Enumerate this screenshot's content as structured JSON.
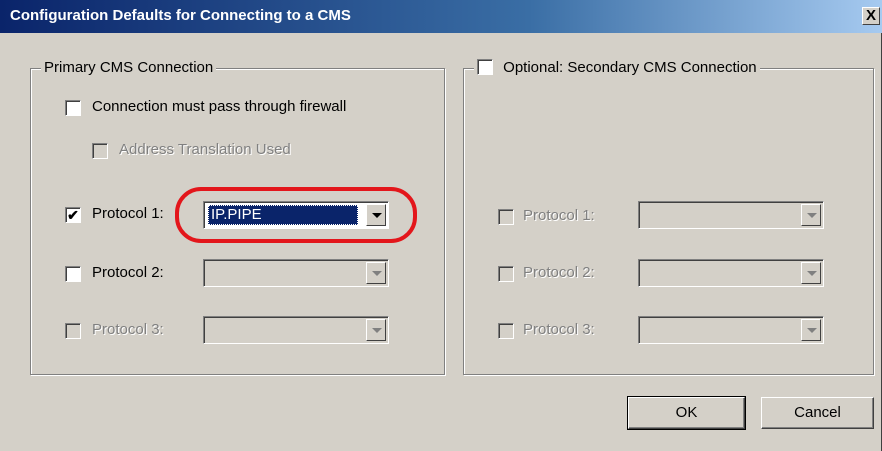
{
  "window": {
    "title": "Configuration Defaults for Connecting to a CMS",
    "close_label": "X"
  },
  "primary": {
    "legend": "Primary CMS Connection",
    "firewall_label": "Connection must pass through firewall",
    "firewall_checked": false,
    "address_translation_label": "Address Translation Used",
    "protocol1_label": "Protocol 1:",
    "protocol1_checked": true,
    "protocol1_value": "IP.PIPE",
    "protocol2_label": "Protocol 2:",
    "protocol2_checked": false,
    "protocol3_label": "Protocol 3:",
    "protocol3_checked": false
  },
  "secondary": {
    "legend": "Optional: Secondary CMS Connection",
    "checked": false,
    "protocol1_label": "Protocol 1:",
    "protocol2_label": "Protocol 2:",
    "protocol3_label": "Protocol 3:"
  },
  "buttons": {
    "ok": "OK",
    "cancel": "Cancel"
  },
  "colors": {
    "highlight_circle": "#e3161b",
    "title_bar": "#0a246a",
    "selection": "#0a246a"
  },
  "checkmark": "✔"
}
